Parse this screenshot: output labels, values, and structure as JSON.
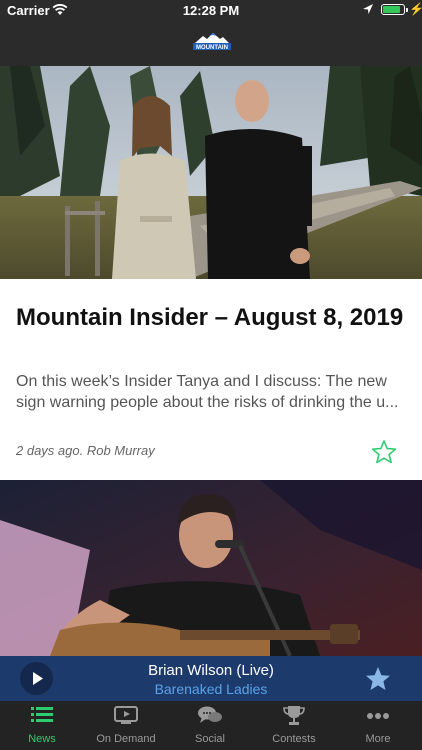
{
  "status_bar": {
    "carrier": "Carrier",
    "time": "12:28 PM",
    "battery_level": 0.9
  },
  "navbar": {
    "logo_text": "MOUNTAIN"
  },
  "articles": [
    {
      "title": "Mountain Insider – August 8, 2019",
      "summary_line1": "On this week’s Insider Tanya and I discuss: The new",
      "summary_line2": "sign warning people about the risks of drinking the u...",
      "meta": "2 days ago. Rob Murray"
    }
  ],
  "player": {
    "song": "Brian Wilson (Live)",
    "artist": "Barenaked Ladies"
  },
  "tabs": [
    {
      "label": "News",
      "icon": "list-icon",
      "active": true
    },
    {
      "label": "On Demand",
      "icon": "tv-icon"
    },
    {
      "label": "Social",
      "icon": "chat-bubbles-icon"
    },
    {
      "label": "Contests",
      "icon": "trophy-icon"
    },
    {
      "label": "More",
      "icon": "ellipsis-icon"
    }
  ],
  "colors": {
    "accent": "#2ecc71",
    "player_bg": "#1c3a6b",
    "artist_blue": "#5aa3e8",
    "bar_bg": "#2b2b2b"
  }
}
